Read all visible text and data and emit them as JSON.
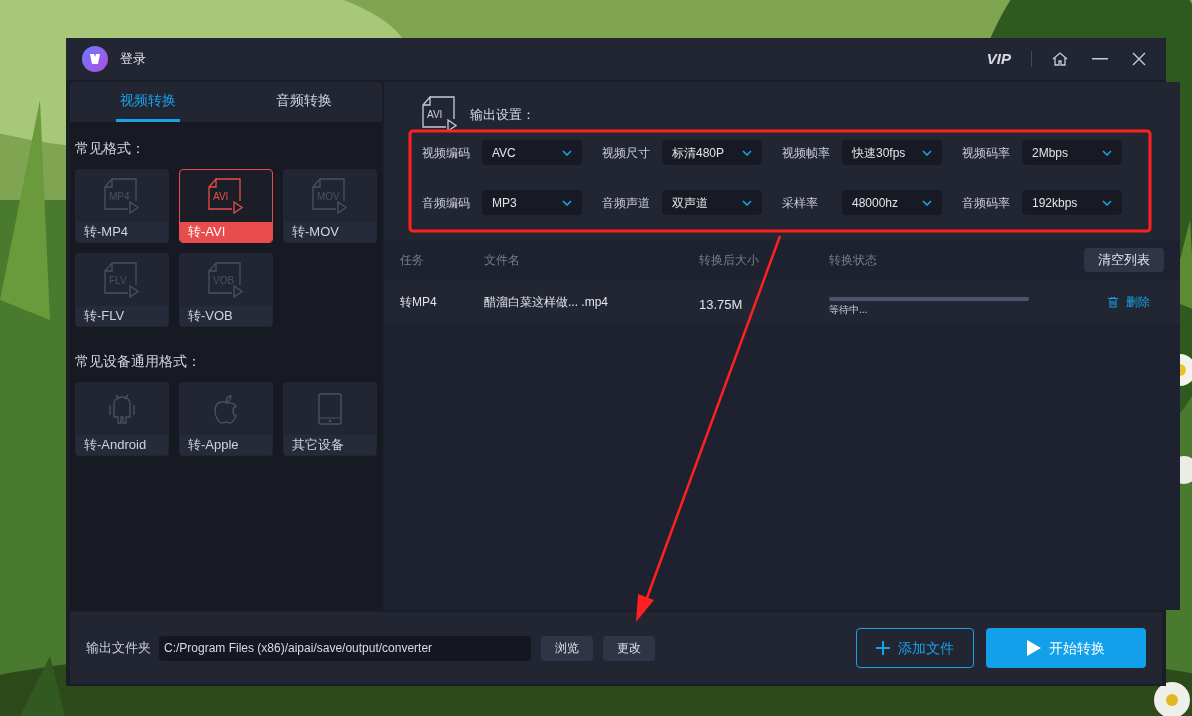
{
  "window": {
    "title": "登录",
    "vip": "VIP"
  },
  "tabs": [
    {
      "label": "视频转换",
      "selected": true
    },
    {
      "label": "音频转换",
      "selected": false
    }
  ],
  "sections": [
    {
      "title": "常见格式：",
      "tiles": [
        {
          "kind": "format",
          "badge": "MP4",
          "label": "转-MP4",
          "selected": false
        },
        {
          "kind": "format",
          "badge": "AVI",
          "label": "转-AVI",
          "selected": true
        },
        {
          "kind": "format",
          "badge": "MOV",
          "label": "转-MOV",
          "selected": false
        },
        {
          "kind": "format",
          "badge": "FLV",
          "label": "转-FLV",
          "selected": false
        },
        {
          "kind": "format",
          "badge": "VOB",
          "label": "转-VOB",
          "selected": false
        }
      ]
    },
    {
      "title": "常见设备通用格式：",
      "tiles": [
        {
          "kind": "android",
          "label": "转-Android",
          "selected": false
        },
        {
          "kind": "apple",
          "label": "转-Apple",
          "selected": false
        },
        {
          "kind": "device",
          "label": "其它设备",
          "selected": false
        }
      ]
    }
  ],
  "output_settings": {
    "badge": "AVI",
    "title": "输出设置：",
    "fields": [
      {
        "label": "视频编码",
        "value": "AVC"
      },
      {
        "label": "视频尺寸",
        "value": "标清480P"
      },
      {
        "label": "视频帧率",
        "value": "快速30fps"
      },
      {
        "label": "视频码率",
        "value": "2Mbps"
      },
      {
        "label": "音频编码",
        "value": "MP3"
      },
      {
        "label": "音频声道",
        "value": "双声道"
      },
      {
        "label": "采样率",
        "value": "48000hz"
      },
      {
        "label": "音频码率",
        "value": "192kbps"
      }
    ]
  },
  "table": {
    "columns": [
      "任务",
      "文件名",
      "转换后大小",
      "转换状态"
    ],
    "clear_button": "清空列表",
    "rows": [
      {
        "task": "转MP4",
        "filename": "醋溜白菜这样做... .mp4",
        "size": "13.75M",
        "level": 0,
        "status": "等待中...",
        "delete": "删除"
      }
    ]
  },
  "footer": {
    "label": "输出文件夹",
    "path": "C:/Program Files (x86)/aipai/save/output/converter",
    "buttons": [
      "浏览",
      "更改"
    ],
    "add_button": "添加文件",
    "start_button": "开始转换"
  }
}
